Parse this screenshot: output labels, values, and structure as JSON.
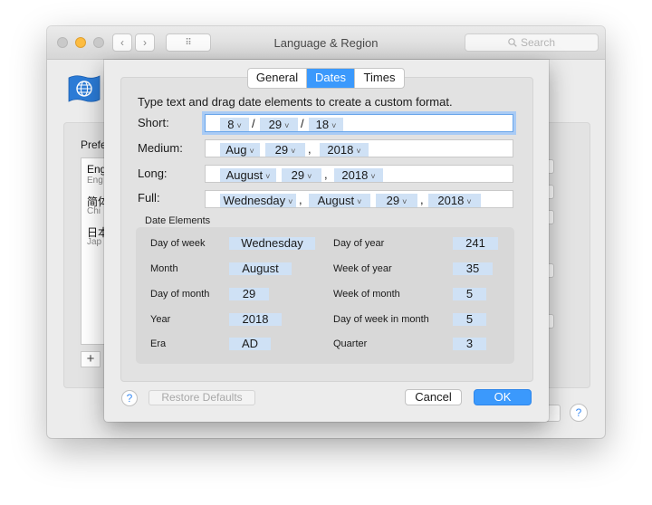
{
  "window": {
    "title": "Language & Region",
    "search_placeholder": "Search",
    "back_symbol": "‹",
    "forward_symbol": "›",
    "grid_symbol": "⠿",
    "traffic_colors": [
      "#fc605c",
      "#fdbc40",
      "#34c84a"
    ],
    "pref_label": "Prefe",
    "languages": [
      {
        "name": "Eng",
        "sub": "Eng"
      },
      {
        "name": "简体",
        "sub": "Chi"
      },
      {
        "name": "日本",
        "sub": "Jap"
      }
    ],
    "add_symbol": "+",
    "help_symbol": "?"
  },
  "sheet": {
    "tabs": [
      "General",
      "Dates",
      "Times"
    ],
    "selected_tab": "Dates",
    "instructions": "Type text and drag date elements to create a custom format.",
    "rows": {
      "short": {
        "label": "Short:",
        "tokens": [
          "8",
          "29",
          "18"
        ],
        "separators": [
          "/",
          "/"
        ]
      },
      "medium": {
        "label": "Medium:",
        "tokens": [
          "Aug",
          "29",
          "2018"
        ],
        "separators": [
          "",
          ","
        ]
      },
      "long": {
        "label": "Long:",
        "tokens": [
          "August",
          "29",
          "2018"
        ],
        "separators": [
          "",
          ","
        ]
      },
      "full": {
        "label": "Full:",
        "tokens": [
          "Wednesday",
          "August",
          "29",
          "2018"
        ],
        "separators": [
          ",",
          "",
          ","
        ]
      }
    },
    "elements_heading": "Date Elements",
    "elements": [
      {
        "label": "Day of week",
        "value": "Wednesday"
      },
      {
        "label": "Month",
        "value": "August"
      },
      {
        "label": "Day of month",
        "value": "29"
      },
      {
        "label": "Year",
        "value": "2018"
      },
      {
        "label": "Era",
        "value": "AD"
      },
      {
        "label": "Day of year",
        "value": "241"
      },
      {
        "label": "Week of year",
        "value": "35"
      },
      {
        "label": "Week of month",
        "value": "5"
      },
      {
        "label": "Day of week in month",
        "value": "5"
      },
      {
        "label": "Quarter",
        "value": "3"
      }
    ],
    "help_symbol": "?",
    "restore_label": "Restore Defaults",
    "cancel_label": "Cancel",
    "ok_label": "OK",
    "chevron_symbol": "˅"
  },
  "colors": {
    "accent": "#3b99fc",
    "token_background": "#cfe1f5",
    "focus_ring": "#a9cbf5"
  },
  "icons": [
    "flag-globe-icon",
    "back-icon",
    "forward-icon",
    "grid-icon",
    "search-icon",
    "chevron-down-icon",
    "help-icon",
    "plus-icon"
  ]
}
